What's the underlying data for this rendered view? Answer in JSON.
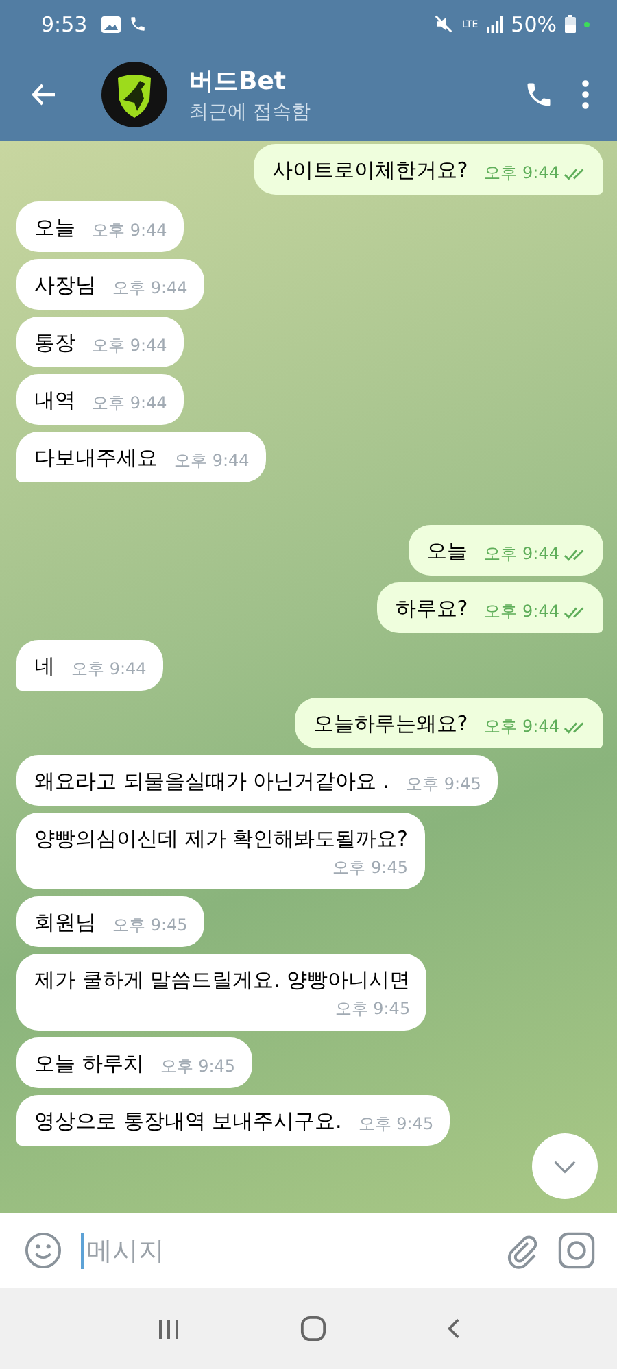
{
  "status_bar": {
    "time": "9:53",
    "network": "LTE",
    "battery": "50%"
  },
  "header": {
    "title": "버드Bet",
    "subtitle": "최근에 접속함"
  },
  "messages": [
    {
      "kind": "outgoing",
      "text": "사이트로이체한거요?",
      "time": "오후 9:44",
      "read": true,
      "tail": true,
      "wrap": false
    },
    {
      "kind": "incoming",
      "text": "오늘",
      "time": "오후 9:44",
      "tail": false,
      "wrap": false
    },
    {
      "kind": "incoming",
      "text": "사장님",
      "time": "오후 9:44",
      "tail": false,
      "wrap": false
    },
    {
      "kind": "incoming",
      "text": "통장",
      "time": "오후 9:44",
      "tail": false,
      "wrap": false
    },
    {
      "kind": "incoming",
      "text": "내역",
      "time": "오후 9:44",
      "tail": false,
      "wrap": false
    },
    {
      "kind": "incoming",
      "text": "다보내주세요",
      "time": "오후 9:44",
      "tail": true,
      "wrap": false
    },
    {
      "kind": "outgoing",
      "text": "오늘",
      "time": "오후 9:44",
      "read": true,
      "tail": false,
      "wrap": false
    },
    {
      "kind": "outgoing",
      "text": "하루요?",
      "time": "오후 9:44",
      "read": true,
      "tail": true,
      "wrap": false
    },
    {
      "kind": "incoming",
      "text": "네",
      "time": "오후 9:44",
      "tail": true,
      "wrap": false
    },
    {
      "kind": "outgoing",
      "text": "오늘하루는왜요?",
      "time": "오후 9:44",
      "read": true,
      "tail": true,
      "wrap": false
    },
    {
      "kind": "incoming",
      "text": "왜요라고 되물을실때가 아닌거같아요 .",
      "time": "오후 9:45",
      "tail": false,
      "wrap": false
    },
    {
      "kind": "incoming",
      "text": "양빵의심이신데 제가 확인해봐도될까요?",
      "time": "오후 9:45",
      "tail": false,
      "wrap": true
    },
    {
      "kind": "incoming",
      "text": "회원님",
      "time": "오후 9:45",
      "tail": false,
      "wrap": false
    },
    {
      "kind": "incoming",
      "text": "제가 쿨하게 말씀드릴게요.  양빵아니시면",
      "time": "오후 9:45",
      "tail": false,
      "wrap": true
    },
    {
      "kind": "incoming",
      "text": "오늘 하루치",
      "time": "오후 9:45",
      "tail": false,
      "wrap": false
    },
    {
      "kind": "incoming",
      "text": "영상으로 통장내역 보내주시구요.",
      "time": "오후 9:45",
      "tail": true,
      "wrap": false
    }
  ],
  "composer": {
    "placeholder": "메시지"
  }
}
